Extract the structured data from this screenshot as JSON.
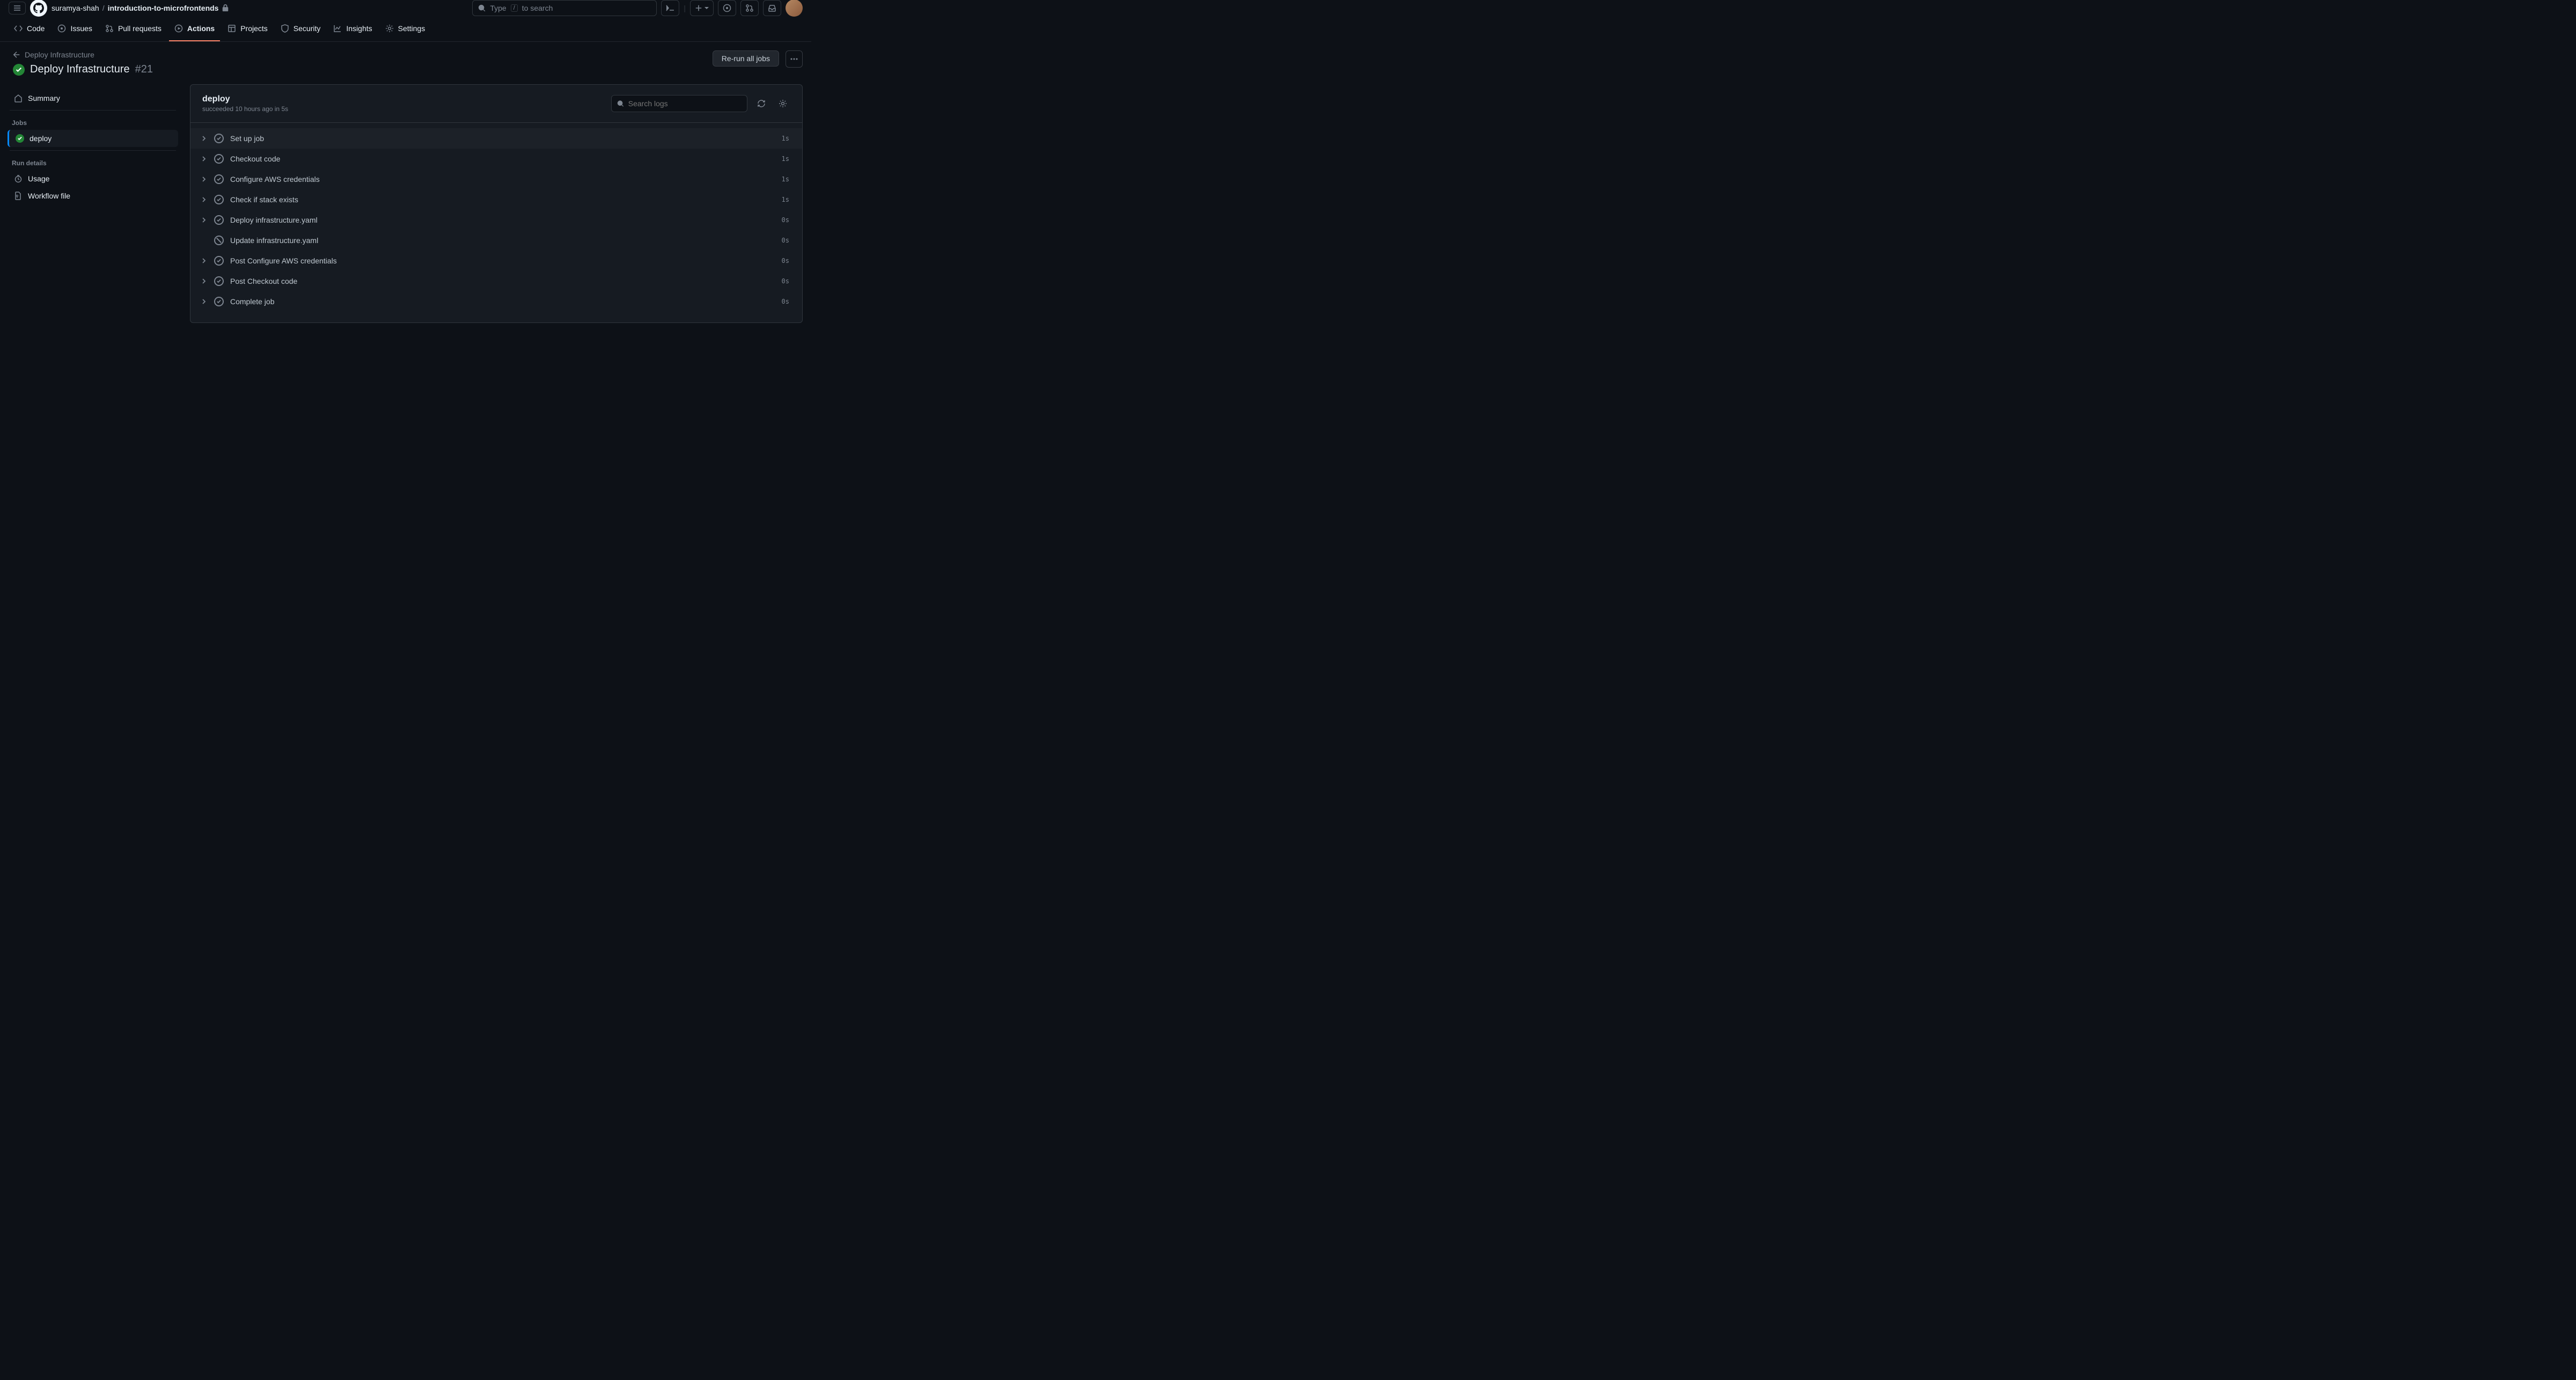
{
  "header": {
    "owner": "suramya-shah",
    "repo": "introduction-to-microfrontends",
    "search_prefix": "Type",
    "search_key": "/",
    "search_suffix": "to search"
  },
  "tabs": {
    "code": "Code",
    "issues": "Issues",
    "pulls": "Pull requests",
    "actions": "Actions",
    "projects": "Projects",
    "security": "Security",
    "insights": "Insights",
    "settings": "Settings"
  },
  "workflow": {
    "back": "Deploy Infrastructure",
    "title": "Deploy Infrastructure",
    "run_number": "#21",
    "rerun": "Re-run all jobs"
  },
  "sidebar": {
    "summary": "Summary",
    "jobs_heading": "Jobs",
    "job": "deploy",
    "run_details_heading": "Run details",
    "usage": "Usage",
    "workflow_file": "Workflow file"
  },
  "panel": {
    "job_name": "deploy",
    "status_line": "succeeded 10 hours ago in 5s",
    "search_placeholder": "Search logs"
  },
  "steps": [
    {
      "name": "Set up job",
      "duration": "1s",
      "expandable": true,
      "status": "success"
    },
    {
      "name": "Checkout code",
      "duration": "1s",
      "expandable": true,
      "status": "success"
    },
    {
      "name": "Configure AWS credentials",
      "duration": "1s",
      "expandable": true,
      "status": "success"
    },
    {
      "name": "Check if stack exists",
      "duration": "1s",
      "expandable": true,
      "status": "success"
    },
    {
      "name": "Deploy infrastructure.yaml",
      "duration": "0s",
      "expandable": true,
      "status": "success"
    },
    {
      "name": "Update infrastructure.yaml",
      "duration": "0s",
      "expandable": false,
      "status": "skipped"
    },
    {
      "name": "Post Configure AWS credentials",
      "duration": "0s",
      "expandable": true,
      "status": "success"
    },
    {
      "name": "Post Checkout code",
      "duration": "0s",
      "expandable": true,
      "status": "success"
    },
    {
      "name": "Complete job",
      "duration": "0s",
      "expandable": true,
      "status": "success"
    }
  ]
}
